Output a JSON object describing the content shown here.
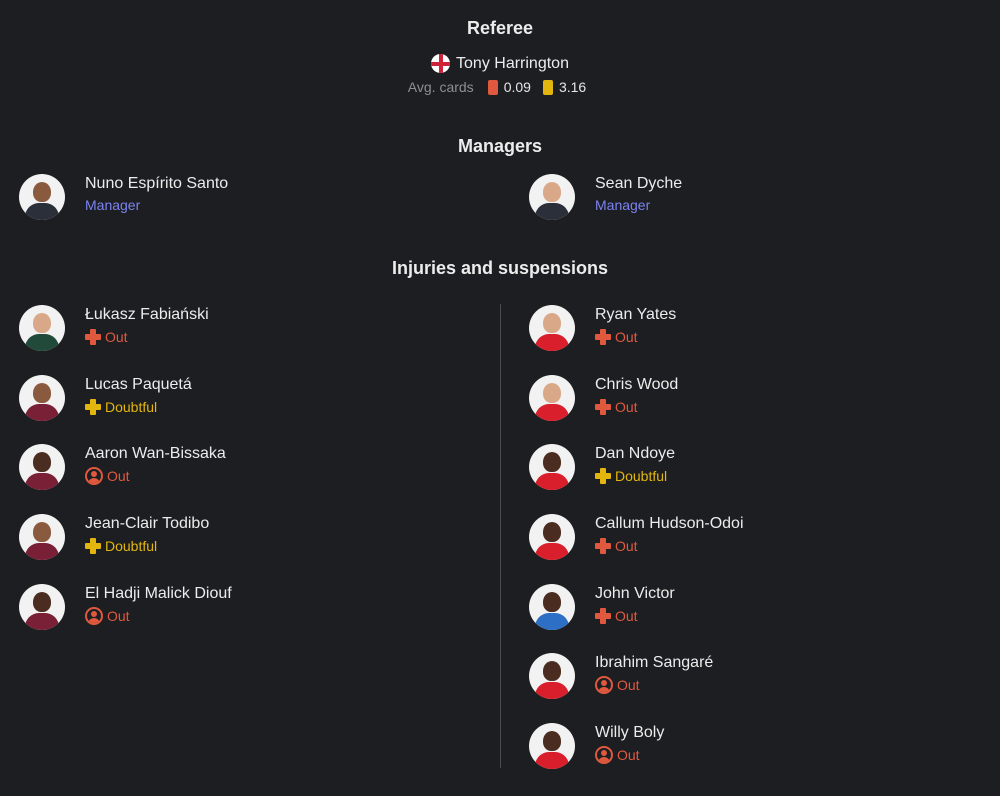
{
  "referee": {
    "title": "Referee",
    "name": "Tony Harrington",
    "avg_cards_label": "Avg. cards",
    "red_avg": "0.09",
    "yellow_avg": "3.16"
  },
  "managers": {
    "title": "Managers",
    "items": [
      {
        "name": "Nuno Espírito Santo",
        "role": "Manager"
      },
      {
        "name": "Sean Dyche",
        "role": "Manager"
      }
    ]
  },
  "injuries": {
    "title": "Injuries and suspensions",
    "left": [
      {
        "name": "Łukasz Fabiański",
        "status": "Out",
        "type": "injury"
      },
      {
        "name": "Lucas Paquetá",
        "status": "Doubtful",
        "type": "doubtful"
      },
      {
        "name": "Aaron Wan-Bissaka",
        "status": "Out",
        "type": "suspension"
      },
      {
        "name": "Jean-Clair Todibo",
        "status": "Doubtful",
        "type": "doubtful"
      },
      {
        "name": "El Hadji Malick Diouf",
        "status": "Out",
        "type": "suspension"
      }
    ],
    "right": [
      {
        "name": "Ryan Yates",
        "status": "Out",
        "type": "injury"
      },
      {
        "name": "Chris Wood",
        "status": "Out",
        "type": "injury"
      },
      {
        "name": "Dan Ndoye",
        "status": "Doubtful",
        "type": "doubtful"
      },
      {
        "name": "Callum Hudson-Odoi",
        "status": "Out",
        "type": "injury"
      },
      {
        "name": "John Victor",
        "status": "Out",
        "type": "injury"
      },
      {
        "name": "Ibrahim Sangaré",
        "status": "Out",
        "type": "suspension"
      },
      {
        "name": "Willy Boly",
        "status": "Out",
        "type": "suspension"
      }
    ]
  },
  "colors": {
    "background": "#1d1e21",
    "out": "#e0593f",
    "doubtful": "#e3b60f",
    "role": "#7b83f0",
    "red_card": "#e0593f",
    "yellow_card": "#e3b60f"
  }
}
